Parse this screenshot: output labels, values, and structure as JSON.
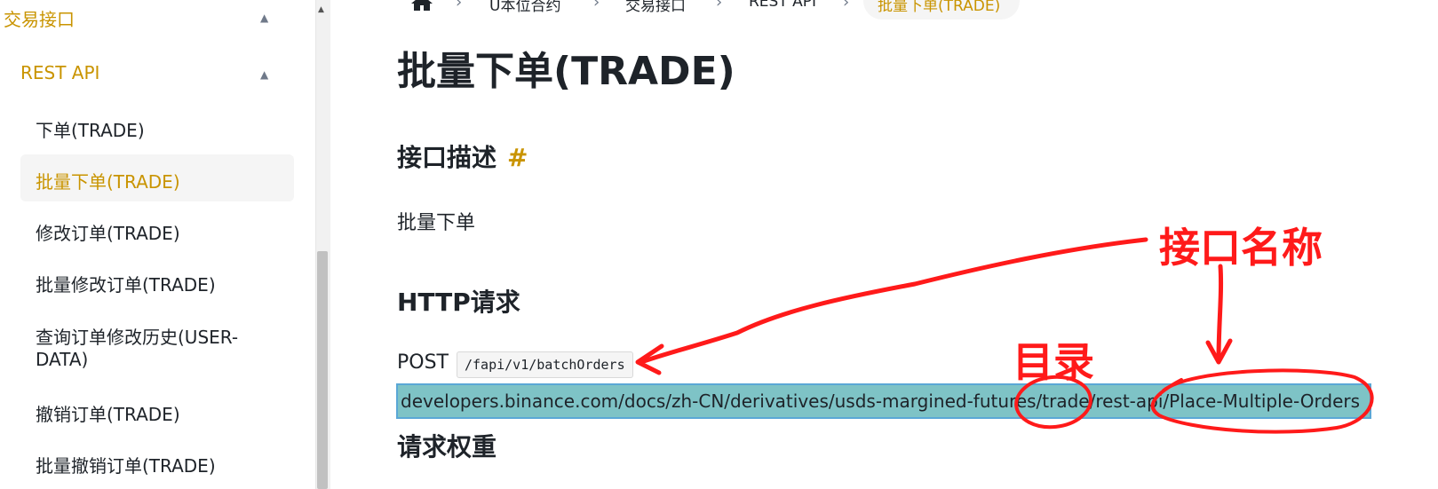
{
  "sidebar": {
    "section_title": "交易接口",
    "subsection_title": "REST API",
    "items": [
      {
        "label": "下单(TRADE)"
      },
      {
        "label": "批量下单(TRADE)",
        "active": true
      },
      {
        "label": "修改订单(TRADE)"
      },
      {
        "label": "批量修改订单(TRADE)"
      },
      {
        "label_line1": "查询订单修改历史(USER-",
        "label_line2": "DATA)"
      },
      {
        "label": "撤销订单(TRADE)"
      },
      {
        "label": "批量撤销订单(TRADE)"
      }
    ]
  },
  "breadcrumb": {
    "home_icon": "home-icon",
    "items": [
      "U本位合约",
      "交易接口",
      "REST API",
      "批量下单(TRADE)"
    ]
  },
  "page": {
    "title": "批量下单(TRADE)",
    "section_desc_heading": "接口描述",
    "section_desc_anchor": "#",
    "desc_text": "批量下单",
    "http_heading": "HTTP请求",
    "method": "POST",
    "endpoint": "/fapi/v1/batchOrders",
    "url_text": "developers.binance.com/docs/zh-CN/derivatives/usds-margined-futures/trade/rest-api/Place-Multiple-Orders",
    "weight_heading": "请求权重"
  },
  "annotations": {
    "interface_name": "接口名称",
    "directory": "目录",
    "color": "#ff1a1a"
  },
  "colors": {
    "accent_gold": "#c99400",
    "url_highlight": "#7ec3c6"
  }
}
